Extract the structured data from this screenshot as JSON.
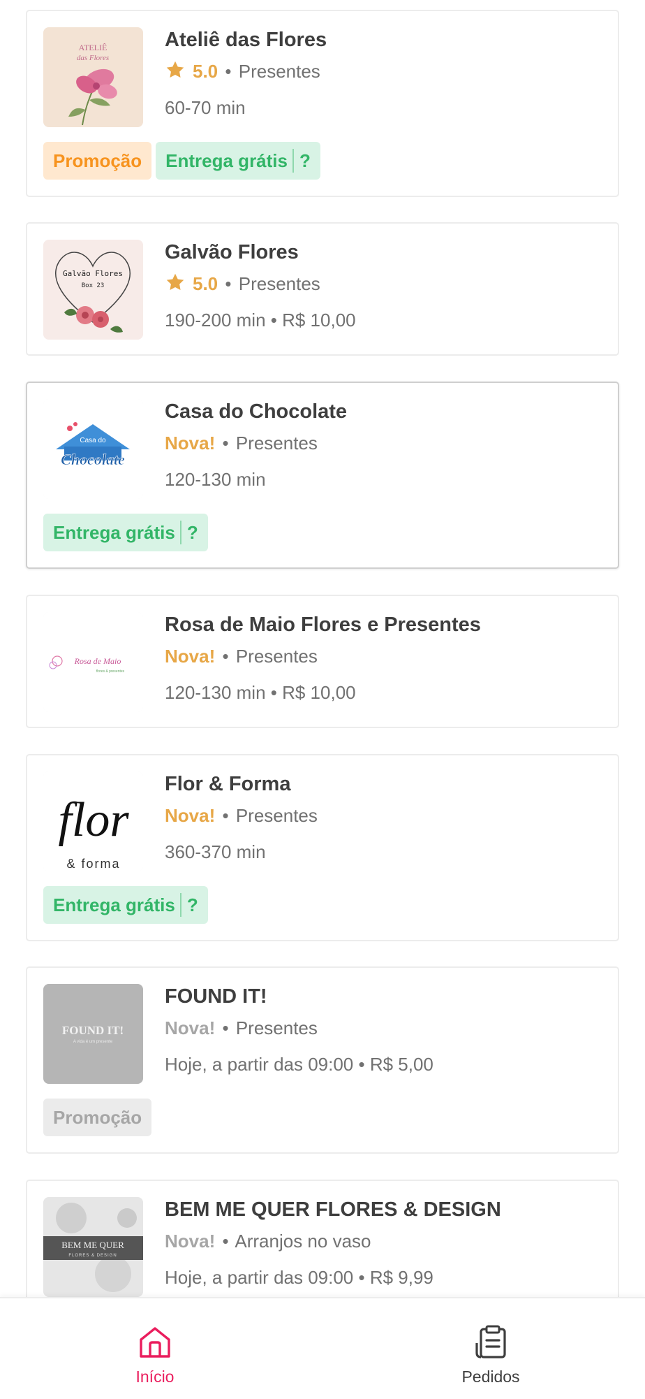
{
  "stores": [
    {
      "name": "Ateliê das Flores",
      "rating": "5.0",
      "category": "Presentes",
      "time": "60-70 min",
      "tags": {
        "promo": "Promoção",
        "free": "Entrega grátis",
        "help": "?"
      },
      "logo_text": [
        "ATELIÊ",
        "das Flores"
      ]
    },
    {
      "name": "Galvão Flores",
      "rating": "5.0",
      "category": "Presentes",
      "time": "190-200 min • R$ 10,00",
      "logo_text": [
        "Galvão Flores",
        "Box 23"
      ]
    },
    {
      "name": "Casa do Chocolate",
      "badge": "Nova!",
      "category": "Presentes",
      "time": "120-130 min",
      "tags": {
        "free": "Entrega grátis",
        "help": "?"
      },
      "logo_text": [
        "Casa do",
        "Chocolate"
      ]
    },
    {
      "name": "Rosa de Maio Flores e Presentes",
      "badge": "Nova!",
      "category": "Presentes",
      "time": "120-130 min • R$ 10,00",
      "logo_text": [
        "Rosa de Maio",
        "flores & presentes"
      ]
    },
    {
      "name": "Flor & Forma",
      "badge": "Nova!",
      "category": "Presentes",
      "time": "360-370 min",
      "tags": {
        "free": "Entrega grátis",
        "help": "?"
      },
      "logo_text": [
        "flor",
        "& forma"
      ]
    },
    {
      "name": "FOUND IT!",
      "badge": "Nova!",
      "category": "Presentes",
      "time": "Hoje, a partir das 09:00 • R$ 5,00",
      "tags": {
        "promo": "Promoção"
      },
      "logo_text": [
        "FOUND IT!",
        "A vida é um presente"
      ]
    },
    {
      "name": "BEM ME QUER FLORES & DESIGN",
      "badge": "Nova!",
      "category": "Arranjos no vaso",
      "time": "Hoje, a partir das 09:00 • R$ 9,99",
      "logo_text": [
        "BEM ME QUER",
        "FLORES & DESIGN"
      ]
    }
  ],
  "separator": "•",
  "bottom_nav": {
    "home": {
      "label": "Início",
      "icon": "home-icon"
    },
    "orders": {
      "label": "Pedidos",
      "icon": "clipboard-icon"
    }
  },
  "colors": {
    "accent": "#ea1d5d",
    "rating": "#e7a747",
    "promo_bg": "#ffe8cf",
    "promo_text": "#f7931e",
    "free_bg": "#d8f3e5",
    "free_text": "#32b567"
  }
}
